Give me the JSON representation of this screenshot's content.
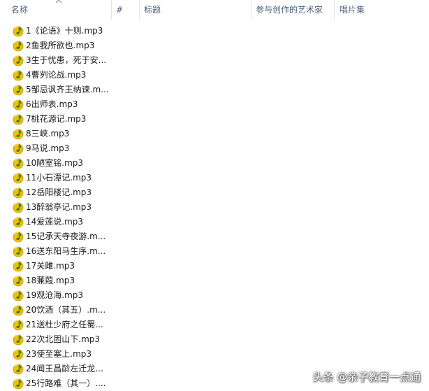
{
  "columns": {
    "name": "名称",
    "number": "#",
    "title": "标题",
    "artist": "参与创作的艺术家",
    "album": "唱片集"
  },
  "icons": {
    "file": "music-note-icon",
    "sort": "sort-ascending-icon"
  },
  "colors": {
    "header_text": "#4c607a",
    "icon_yellow": "#f0c000",
    "icon_green": "#4caf50"
  },
  "files": [
    "1《论语》十则.mp3",
    "2鱼我所欲也.mp3",
    "3生于忧患，死于安...",
    "4曹刿论战.mp3",
    "5邹忌讽齐王纳谏.m...",
    "6出师表.mp3",
    "7桃花源记.mp3",
    "8三峡.mp3",
    "9马说.mp3",
    "10陋室铭.mp3",
    "11小石潭记.mp3",
    "12岳阳楼记.mp3",
    "13醉翁亭记.mp3",
    "14爱莲说.mp3",
    "15记承天寺夜游.m...",
    "16送东阳马生序.m...",
    "17关雎.mp3",
    "18蒹葭.mp3",
    "19观沧海.mp3",
    "20饮酒（其五）.m...",
    "21送杜少府之任蜀...",
    "22次北固山下.mp3",
    "23使至塞上.mp3",
    "24闻王昌龄左迁龙...",
    "25行路难（其一）...."
  ],
  "watermark": "头条 @亲子教育一点通"
}
